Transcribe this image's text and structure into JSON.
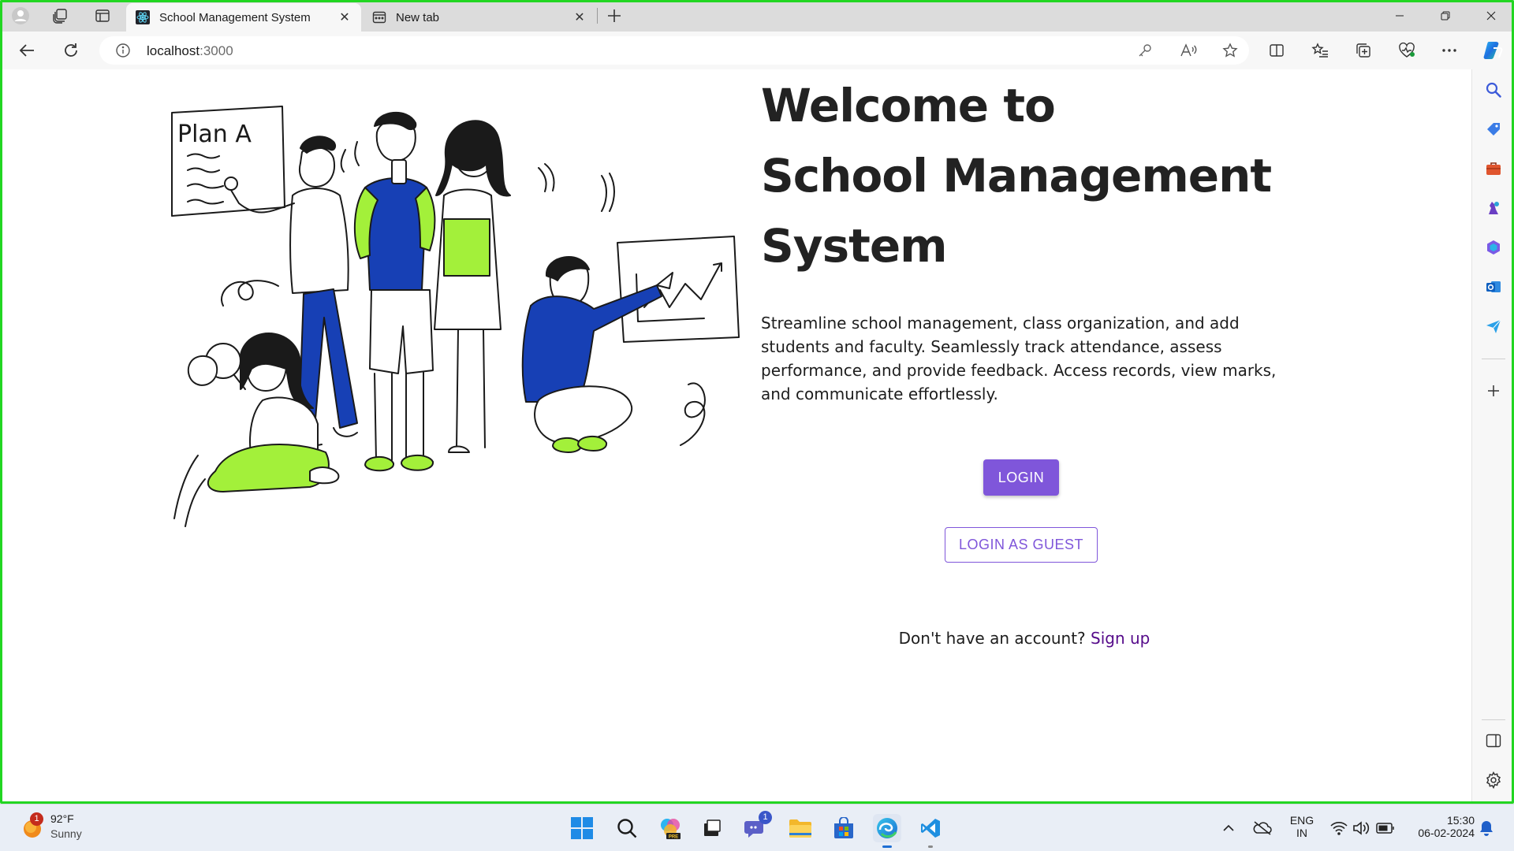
{
  "browser": {
    "tabs": [
      {
        "title": "School Management System",
        "active": true
      },
      {
        "title": "New tab",
        "active": false
      }
    ],
    "url_host": "localhost",
    "url_port": ":3000"
  },
  "hero": {
    "title_line1": "Welcome to",
    "title_line2": "School Management",
    "title_line3": "System",
    "description": "Streamline school management, class organization, and add students and faculty. Seamlessly track attendance, assess performance, and provide feedback. Access records, view marks, and communicate effortlessly.",
    "login_label": "LOGIN",
    "guest_label": "LOGIN AS GUEST",
    "signup_prompt": "Don't have an account?",
    "signup_link": "Sign up"
  },
  "illustration": {
    "whiteboard_text": "Plan A"
  },
  "taskbar": {
    "weather_temp": "92°F",
    "weather_condition": "Sunny",
    "weather_badge": "1",
    "teams_badge": "1",
    "language_top": "ENG",
    "language_bottom": "IN",
    "time": "15:30",
    "date": "06-02-2024"
  },
  "colors": {
    "accent_purple": "#7f56da",
    "link_purple": "#550a8a",
    "illustration_blue": "#1740b5",
    "illustration_green": "#a3f03a",
    "frame_green": "#22d622"
  }
}
